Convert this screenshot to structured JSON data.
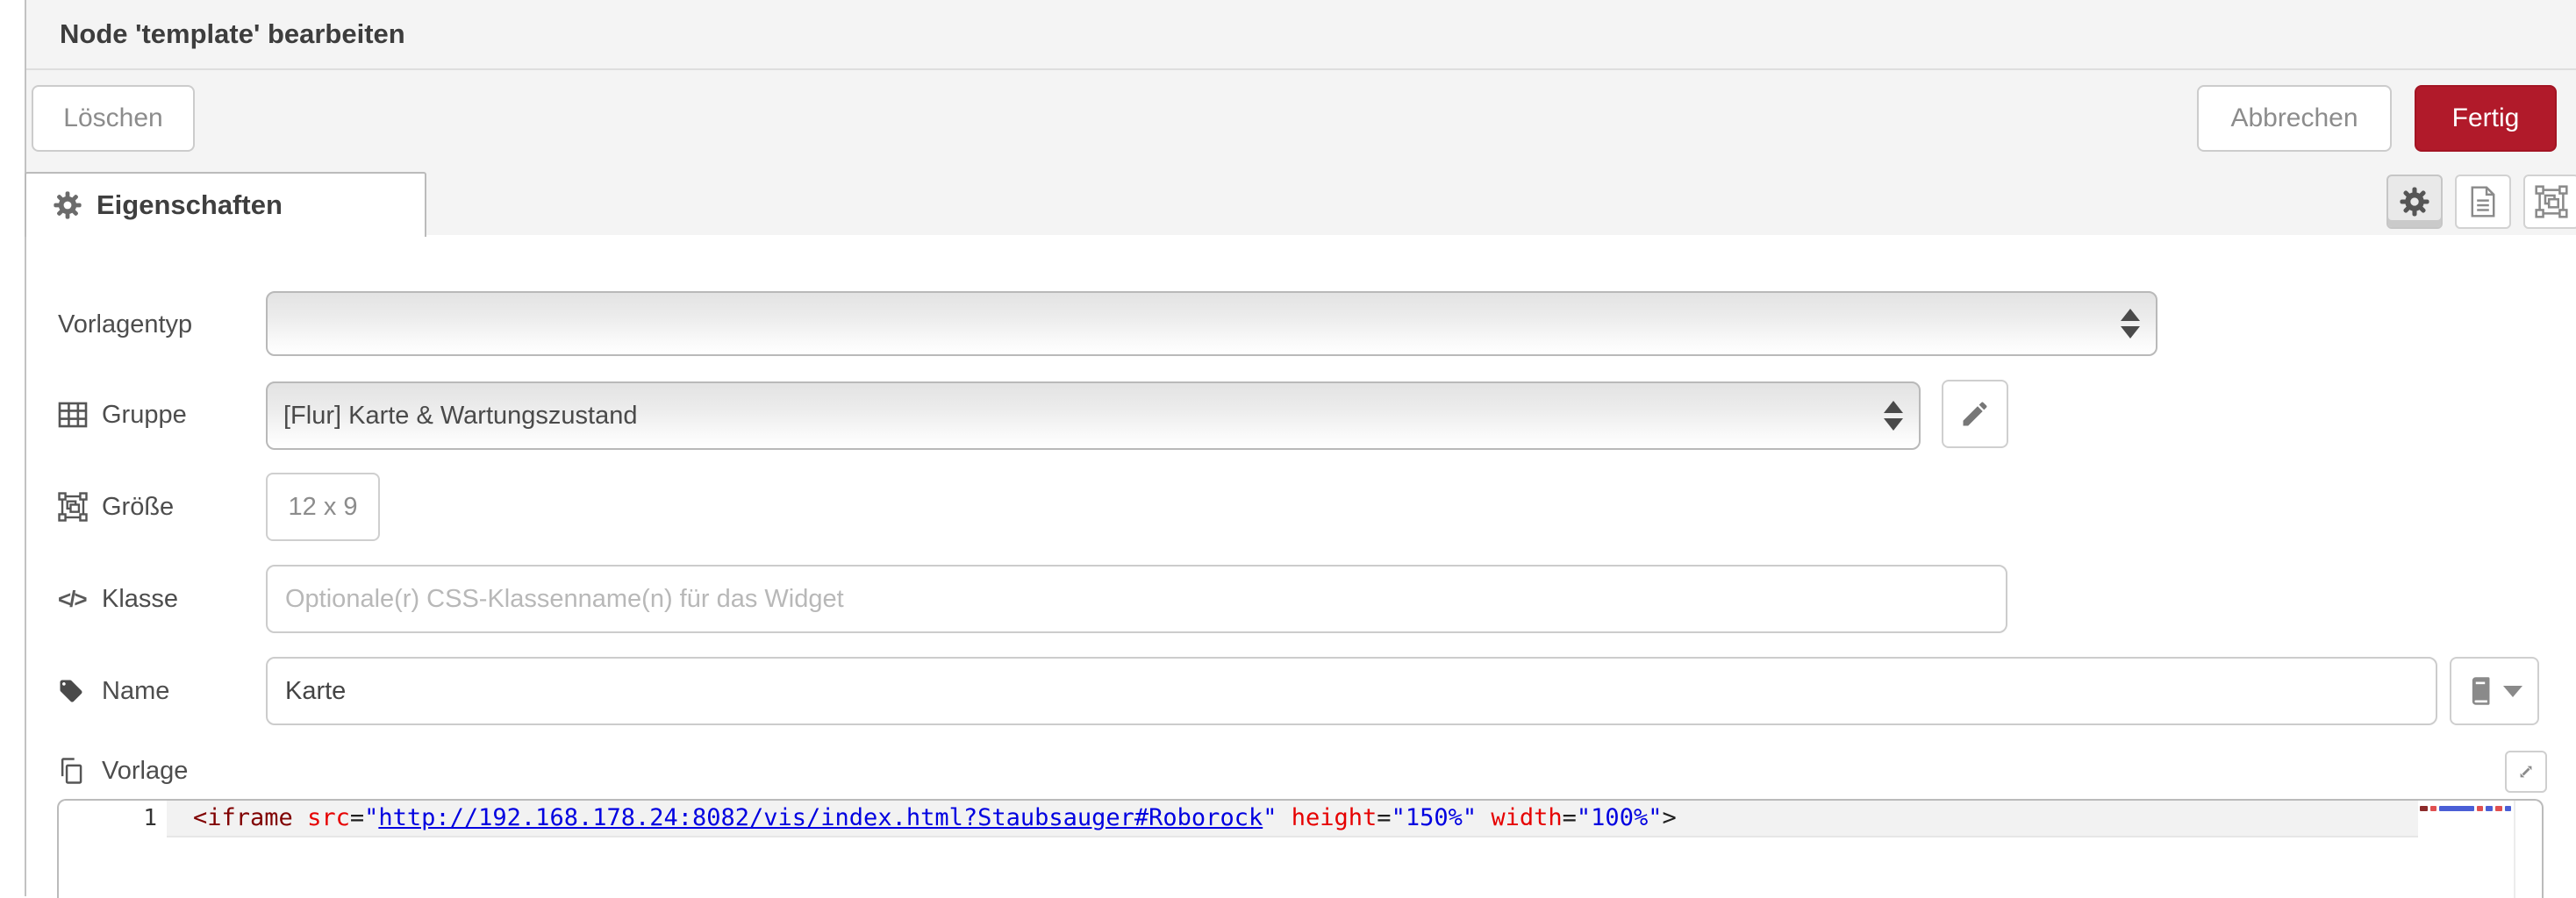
{
  "header": {
    "title": "Node 'template' bearbeiten"
  },
  "toolbar": {
    "delete_label": "Löschen",
    "cancel_label": "Abbrechen",
    "done_label": "Fertig"
  },
  "tabs": {
    "properties_label": "Eigenschaften",
    "icon_buttons": [
      "gear-icon",
      "document-icon",
      "object-group-icon"
    ]
  },
  "form": {
    "template_type": {
      "label": "Vorlagentyp",
      "value": ""
    },
    "group": {
      "label": "Gruppe",
      "value": "[Flur] Karte & Wartungszustand"
    },
    "size": {
      "label": "Größe",
      "value": "12 x 9"
    },
    "css_class": {
      "label": "Klasse",
      "value": "",
      "placeholder": "Optionale(r) CSS-Klassenname(n) für das Widget"
    },
    "name": {
      "label": "Name",
      "value": "Karte"
    },
    "template": {
      "label": "Vorlage"
    }
  },
  "editor": {
    "line_number": "1",
    "code_full": "<iframe src=\"http://192.168.178.24:8082/vis/index.html?Staubsauger#Roborock\" height=\"150%\" width=\"100%\">",
    "code_tokens": [
      {
        "type": "tag",
        "text": "<iframe"
      },
      {
        "type": "plain",
        "text": " "
      },
      {
        "type": "attr",
        "text": "src"
      },
      {
        "type": "plain",
        "text": "="
      },
      {
        "type": "string",
        "text": "\""
      },
      {
        "type": "link",
        "text": "http://192.168.178.24:8082/vis/index.html?Staubsauger#Roborock"
      },
      {
        "type": "string",
        "text": "\""
      },
      {
        "type": "plain",
        "text": " "
      },
      {
        "type": "attr",
        "text": "height"
      },
      {
        "type": "plain",
        "text": "="
      },
      {
        "type": "string",
        "text": "\"150%\""
      },
      {
        "type": "plain",
        "text": " "
      },
      {
        "type": "attr",
        "text": "width"
      },
      {
        "type": "plain",
        "text": "="
      },
      {
        "type": "string",
        "text": "\"100%\""
      },
      {
        "type": "plain",
        "text": ">"
      }
    ],
    "minimap_segments": [
      {
        "w": 10,
        "color": "#8c2b2b"
      },
      {
        "w": 8,
        "color": "#e05050"
      },
      {
        "w": 44,
        "color": "#4a5fd6"
      },
      {
        "w": 8,
        "color": "#e05050"
      },
      {
        "w": 9,
        "color": "#4a5fd6"
      },
      {
        "w": 8,
        "color": "#e05050"
      },
      {
        "w": 8,
        "color": "#4a5fd6"
      }
    ],
    "syntax_colors": {
      "tag": "#800000",
      "attribute": "#e60000",
      "string": "#0000e0",
      "link": "#0000e0",
      "plain": "#1f1f1f"
    }
  },
  "colors": {
    "accent_red": "#b11a2a",
    "panel_gray": "#f4f4f4",
    "border_gray": "#bbbbbb"
  }
}
